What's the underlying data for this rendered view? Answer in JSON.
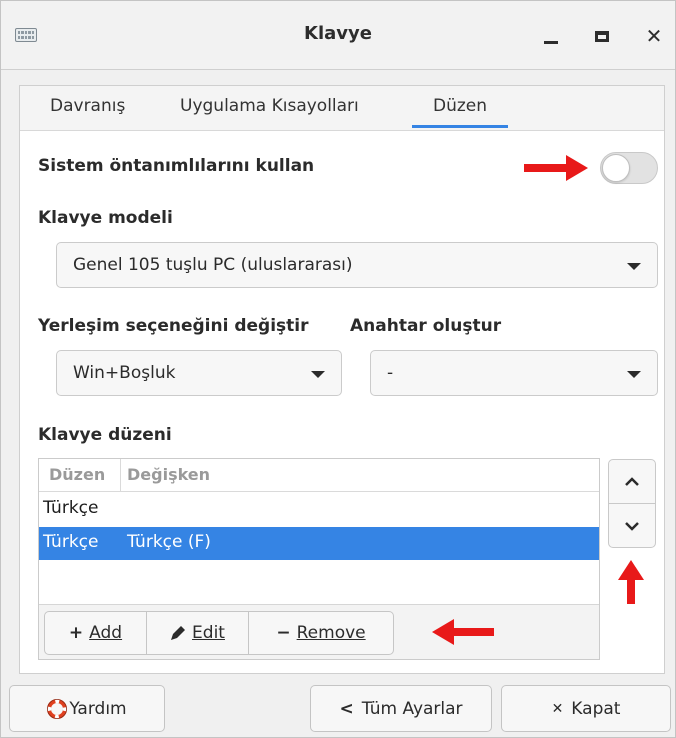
{
  "window": {
    "title": "Klavye"
  },
  "titlebar": {
    "app_icon": "keyboard-icon",
    "minimize_icon": "minimize-icon",
    "maximize_icon": "maximize-icon",
    "close_icon": "close-icon",
    "close_glyph": "✕"
  },
  "tabs": [
    {
      "label": "Davranış",
      "active": false
    },
    {
      "label": "Uygulama Kısayolları",
      "active": false
    },
    {
      "label": "Düzen",
      "active": true
    }
  ],
  "system_defaults": {
    "label": "Sistem öntanımlılarını kullan",
    "enabled": false
  },
  "keyboard_model": {
    "label": "Klavye modeli",
    "value": "Genel 105 tuşlu PC (uluslararası)"
  },
  "layout_switch": {
    "label": "Yerleşim seçeneğini değiştir",
    "value": "Win+Boşluk"
  },
  "compose_key": {
    "label": "Anahtar oluştur",
    "value": "-"
  },
  "keyboard_layout": {
    "label": "Klavye düzeni",
    "columns": [
      "Düzen",
      "Değişken"
    ],
    "rows": [
      {
        "layout": "Türkçe",
        "variant": "",
        "selected": false
      },
      {
        "layout": "Türkçe",
        "variant": "Türkçe (F)",
        "selected": true
      }
    ],
    "add_label": "Add",
    "edit_label": "Edit",
    "remove_label": "Remove"
  },
  "footer": {
    "help_label": "Yardım",
    "all_settings_label": "Tüm Ayarlar",
    "close_label": "Kapat"
  },
  "colors": {
    "accent": "#3584e4",
    "annotation_arrow": "#e81919"
  }
}
